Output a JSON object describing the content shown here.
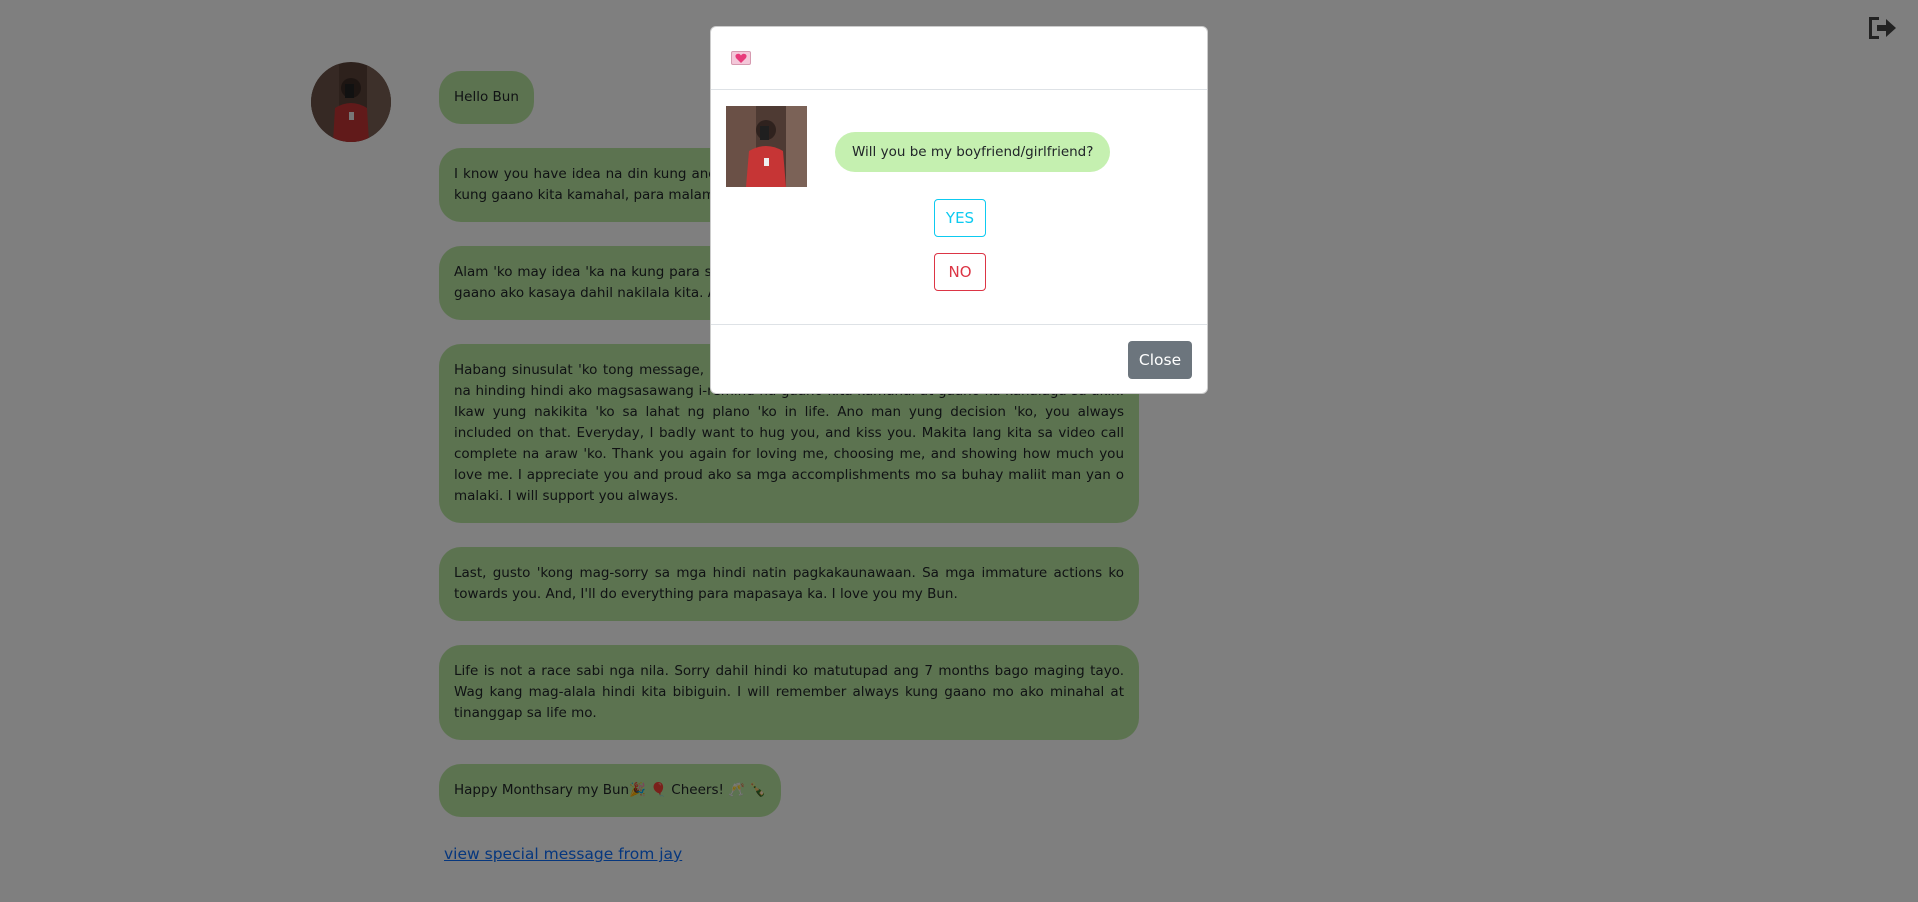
{
  "messages": [
    "Hello Bun",
    "I know you have idea na din kung anong meron sa message na 'to. Gusto 'ko lang ipaalam sa 'yo kung gaano kita kamahal, para malaman mo ano ang nagbago sa akin ngayong kasama kita.",
    "Alam 'ko may idea 'ka na kung para saan 'tong message na 'to. Gusto ko lang sabihin sa 'yo kung gaano ako kasaya dahil nakilala kita. At happy ako na minahal mo ako.",
    "Habang sinusulat 'ko tong message, naka ngiti ako kasi naiisip kita. Gusto ko lang sabihin sa 'yo na hinding hindi ako magsasawang i-remind na gaano kita kamahal at gaano ka kahalaga sa akin. Ikaw yung nakikita 'ko sa lahat ng plano 'ko in life. Ano man yung decision 'ko, you always included on that. Everyday, I badly want to hug you, and kiss you. Makita lang kita sa video call complete na araw 'ko. Thank you again for loving me, choosing me, and showing how much you love me. I appreciate you and proud ako sa mga accomplishments mo sa buhay maliit man yan o malaki. I will support you always.",
    "Last, gusto 'kong mag-sorry sa mga hindi natin pagkakaunawaan. Sa mga immature actions ko towards you. And, I'll do everything para mapasaya ka. I love you my Bun.",
    "Life is not a race sabi nga nila. Sorry dahil hindi ko matutupad ang 7 months bago maging tayo. Wag kang mag-alala hindi kita bibiguin. I will remember always kung gaano mo ako minahal at tinanggap sa life mo.",
    "Happy Monthsary my Bun🎉 🎈 Cheers! 🥂 🍾"
  ],
  "special_link": "view special message from jay",
  "modal": {
    "question": "Will you be my boyfriend/girlfriend?",
    "yes_label": "YES",
    "no_label": "NO",
    "close_label": "Close"
  },
  "colors": {
    "bubble": "#b9e7a0",
    "question_bubble": "#c5f0b0",
    "yes": "#0dcaf0",
    "no": "#dc3545",
    "close": "#6c757d",
    "link": "#0d6efd"
  },
  "icons": {
    "logout": "sign-out-icon",
    "header": "heart-letter-icon"
  }
}
